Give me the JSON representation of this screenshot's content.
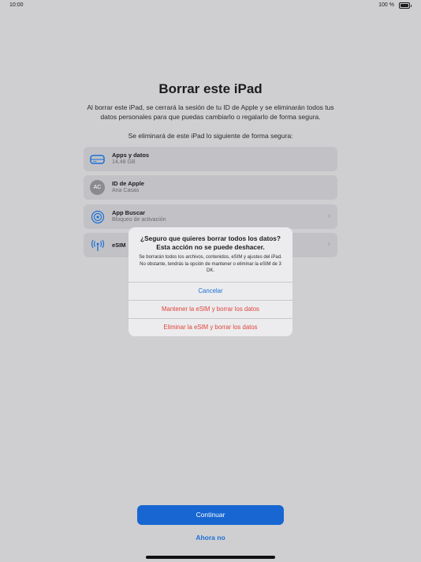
{
  "status": {
    "time": "10:00",
    "battery": "100 %"
  },
  "page": {
    "title": "Borrar este iPad",
    "description": "Al borrar este iPad, se cerrará la sesión de tu ID de Apple y se eliminarán todos tus datos personales para que puedas cambiarlo o regalarlo de forma segura.",
    "subheading": "Se eliminará de este iPad lo siguiente de forma segura:"
  },
  "items": [
    {
      "title": "Apps y datos",
      "subtitle": "14,48 GB",
      "icon": "storage-icon"
    },
    {
      "title": "ID de Apple",
      "subtitle": "Ana Casas",
      "icon": "avatar",
      "initials": "AC"
    },
    {
      "title": "App Buscar",
      "subtitle": "Bloqueo de activación",
      "icon": "find-my-icon"
    },
    {
      "title": "eSIM",
      "subtitle": "",
      "icon": "antenna-icon"
    }
  ],
  "dialog": {
    "title": "¿Seguro que quieres borrar todos los datos? Esta acción no se puede deshacer.",
    "message": "Se borrarán todos los archivos, contenidos, eSIM y ajustes del iPad. No obstante, tendrás la opción de mantener o eliminar la eSIM de 3 DK.",
    "cancel": "Cancelar",
    "keep": "Mantener la eSIM y borrar los datos",
    "remove": "Eliminar la eSIM y borrar los datos"
  },
  "actions": {
    "continue": "Continuar",
    "not_now": "Ahora no"
  },
  "colors": {
    "accent": "#1766d2",
    "destructive": "#e0443c"
  }
}
